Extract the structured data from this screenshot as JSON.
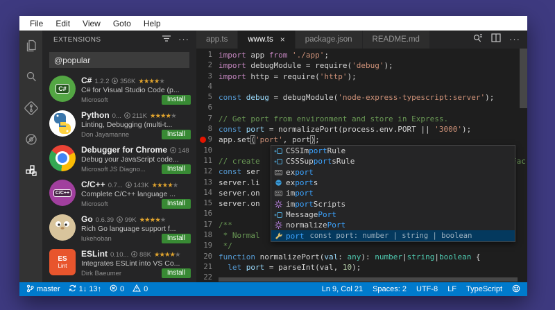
{
  "colors": {
    "accent": "#007acc",
    "desktop_bg": "#3e3a80",
    "editor_bg": "#1e1e1e",
    "sidebar_bg": "#252526",
    "activity_bg": "#333333",
    "install_green": "#388a34",
    "breakpoint_red": "#e51400",
    "suggest_selected_bg": "#04395e",
    "match_blue": "#3ba3ff",
    "star_orange": "#dfa32e"
  },
  "menu": {
    "items": [
      "File",
      "Edit",
      "View",
      "Goto",
      "Help"
    ]
  },
  "activity_bar": {
    "icons": [
      "files",
      "search",
      "source-control",
      "debug",
      "extensions"
    ],
    "active": "extensions"
  },
  "sidebar": {
    "title": "EXTENSIONS",
    "header_icons": [
      "filter",
      "more"
    ],
    "search_value": "@popular",
    "extensions": [
      {
        "name": "C#",
        "version": "1.2.2",
        "downloads": "356K",
        "stars": 4,
        "stars_gray": 1,
        "desc": "C# for Visual Studio Code (p...",
        "publisher": "Microsoft",
        "install": "Install",
        "icon": "csharp",
        "badge": "C#"
      },
      {
        "name": "Python",
        "version": "0...",
        "downloads": "211K",
        "stars": 4,
        "stars_gray": 1,
        "desc": "Linting, Debugging (multi-t...",
        "publisher": "Don Jayamanne",
        "install": "Install",
        "icon": "python",
        "badge": ""
      },
      {
        "name": "Debugger for Chrome",
        "version": "",
        "downloads": "148",
        "stars": 0,
        "stars_gray": 0,
        "desc": "Debug your JavaScript code...",
        "publisher": "Microsoft JS Diagno...",
        "install": "Install",
        "icon": "chrome",
        "badge": ""
      },
      {
        "name": "C/C++",
        "version": "0.7...",
        "downloads": "143K",
        "stars": 4,
        "stars_gray": 1,
        "desc": "Complete C/C++ language ...",
        "publisher": "Microsoft",
        "install": "Install",
        "icon": "cpp",
        "badge": "C/C++"
      },
      {
        "name": "Go",
        "version": "0.6.39",
        "downloads": "99K",
        "stars": 4,
        "stars_gray": 1,
        "desc": "Rich Go language support f...",
        "publisher": "lukehoban",
        "install": "Install",
        "icon": "go",
        "badge": ""
      },
      {
        "name": "ESLint",
        "version": "0.10...",
        "downloads": "88K",
        "stars": 4,
        "stars_gray": 1,
        "desc": "Integrates ESLint into VS Co...",
        "publisher": "Dirk Baeumer",
        "install": "Install",
        "icon": "eslint",
        "badge": "ES|Lint"
      }
    ]
  },
  "tabs": [
    {
      "label": "app.ts",
      "active": false
    },
    {
      "label": "www.ts",
      "active": true,
      "close": "×"
    },
    {
      "label": "package.json",
      "active": false
    },
    {
      "label": "README.md",
      "active": false
    }
  ],
  "editor_actions": {
    "icons": [
      "open-preview",
      "split-editor",
      "more-actions"
    ],
    "more_label": "···"
  },
  "editor": {
    "breakpoint_line": 9,
    "right_fragment": "Fac",
    "lines": [
      {
        "n": 1,
        "tk": [
          [
            "import",
            "kw"
          ],
          [
            " app ",
            "plain"
          ],
          [
            "from",
            "kw"
          ],
          [
            " ",
            "plain"
          ],
          [
            "'./app'",
            "str"
          ],
          [
            ";",
            "plain"
          ]
        ]
      },
      {
        "n": 2,
        "tk": [
          [
            "import",
            "kw"
          ],
          [
            " debugModule = require(",
            "plain"
          ],
          [
            "'debug'",
            "str"
          ],
          [
            ");",
            "plain"
          ]
        ]
      },
      {
        "n": 3,
        "tk": [
          [
            "import",
            "kw"
          ],
          [
            " http = require(",
            "plain"
          ],
          [
            "'http'",
            "str"
          ],
          [
            ");",
            "plain"
          ]
        ]
      },
      {
        "n": 4,
        "tk": []
      },
      {
        "n": 5,
        "tk": [
          [
            "const",
            "kw2"
          ],
          [
            " debug",
            "var"
          ],
          [
            " = debugModule(",
            "plain"
          ],
          [
            "'node-express-typescript:server'",
            "str"
          ],
          [
            ");",
            "plain"
          ]
        ]
      },
      {
        "n": 6,
        "tk": []
      },
      {
        "n": 7,
        "tk": [
          [
            "// Get port from environment and store in Express.",
            "cmt"
          ]
        ]
      },
      {
        "n": 8,
        "tk": [
          [
            "const",
            "kw2"
          ],
          [
            " port",
            "var"
          ],
          [
            " = normalizePort(process.env.PORT || ",
            "plain"
          ],
          [
            "'3000'",
            "str"
          ],
          [
            ");",
            "plain"
          ]
        ]
      },
      {
        "n": 9,
        "tk": [
          [
            "app.set",
            "plain"
          ],
          [
            "(",
            "plain",
            "box"
          ],
          [
            "'port'",
            "str"
          ],
          [
            ", port",
            "plain"
          ],
          [
            ")",
            "plain",
            "box"
          ],
          [
            ";",
            "plain"
          ]
        ]
      },
      {
        "n": 10,
        "tk": []
      },
      {
        "n": 11,
        "tk": [
          [
            "// create",
            "cmt"
          ]
        ]
      },
      {
        "n": 12,
        "tk": [
          [
            "const",
            "kw2"
          ],
          [
            " ser",
            "plain"
          ]
        ]
      },
      {
        "n": 13,
        "tk": [
          [
            "server.li",
            "plain"
          ]
        ]
      },
      {
        "n": 14,
        "tk": [
          [
            "server.on",
            "plain"
          ]
        ]
      },
      {
        "n": 15,
        "tk": [
          [
            "server.on",
            "plain"
          ]
        ]
      },
      {
        "n": 16,
        "tk": []
      },
      {
        "n": 17,
        "tk": [
          [
            "/**",
            "cmt"
          ]
        ]
      },
      {
        "n": 18,
        "tk": [
          [
            " * Normal",
            "cmt"
          ]
        ]
      },
      {
        "n": 19,
        "tk": [
          [
            " */",
            "cmt"
          ]
        ]
      },
      {
        "n": 20,
        "tk": [
          [
            "function",
            "kw2"
          ],
          [
            " normalizePort(",
            "plain"
          ],
          [
            "val",
            "var"
          ],
          [
            ": ",
            "plain"
          ],
          [
            "any",
            "type"
          ],
          [
            "): ",
            "plain"
          ],
          [
            "number",
            "type"
          ],
          [
            "|",
            "plain"
          ],
          [
            "string",
            "type"
          ],
          [
            "|",
            "plain"
          ],
          [
            "boolean",
            "type"
          ],
          [
            " {",
            "plain"
          ]
        ]
      },
      {
        "n": 21,
        "tk": [
          [
            "  ",
            "plain"
          ],
          [
            "let",
            "kw2"
          ],
          [
            " port",
            "var"
          ],
          [
            " = parseInt(val, ",
            "plain"
          ],
          [
            "10",
            "num"
          ],
          [
            ");",
            "plain"
          ]
        ]
      },
      {
        "n": 22,
        "tk": []
      }
    ]
  },
  "suggest": {
    "items": [
      {
        "pre": "CSSIm",
        "match": "port",
        "post": "Rule",
        "kind": "class"
      },
      {
        "pre": "CSSSup",
        "match": "port",
        "post": "sRule",
        "kind": "class"
      },
      {
        "pre": "ex",
        "match": "port",
        "post": "",
        "kind": "keyword"
      },
      {
        "pre": "ex",
        "match": "port",
        "post": "s",
        "kind": "field"
      },
      {
        "pre": "im",
        "match": "port",
        "post": "",
        "kind": "keyword"
      },
      {
        "pre": "im",
        "match": "port",
        "post": "Scripts",
        "kind": "method"
      },
      {
        "pre": "Message",
        "match": "Port",
        "post": "",
        "kind": "class"
      },
      {
        "pre": "normalize",
        "match": "Port",
        "post": "",
        "kind": "method"
      },
      {
        "pre": "",
        "match": "port",
        "post": "",
        "kind": "wrench",
        "selected": true,
        "detail": "const port: number | string | boolean"
      }
    ]
  },
  "status_bar": {
    "left": [
      {
        "icon": "git-branch",
        "label": "master"
      },
      {
        "icon": "sync",
        "label": "1↓ 13↑"
      },
      {
        "icon": "error",
        "label": "0"
      },
      {
        "icon": "warning",
        "label": "0"
      }
    ],
    "right": [
      {
        "icon": "",
        "label": "Ln 9, Col 21"
      },
      {
        "icon": "",
        "label": "Spaces: 2"
      },
      {
        "icon": "",
        "label": "UTF-8"
      },
      {
        "icon": "",
        "label": "LF"
      },
      {
        "icon": "",
        "label": "TypeScript"
      },
      {
        "icon": "smiley",
        "label": ""
      }
    ]
  }
}
